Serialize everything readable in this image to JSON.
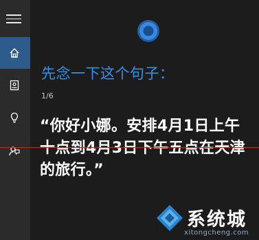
{
  "sidebar": {
    "items": [
      {
        "icon": "home-icon",
        "active": true
      },
      {
        "icon": "notebook-icon",
        "active": false
      },
      {
        "icon": "lightbulb-icon",
        "active": false
      },
      {
        "icon": "feedback-icon",
        "active": false
      }
    ]
  },
  "prompt": {
    "title": "先念一下这个句子：",
    "counter": "1/6",
    "sentence": "“你好小娜。安排4月1日上午十点到4月3日下午五点在天津的旅行。”"
  },
  "watermark": {
    "brand": "系统城",
    "domain": "xitongcheng.com"
  },
  "colors": {
    "accent": "#3d8fe0",
    "sidebar_active": "#2d5b8a",
    "background": "#1c1c1c"
  }
}
